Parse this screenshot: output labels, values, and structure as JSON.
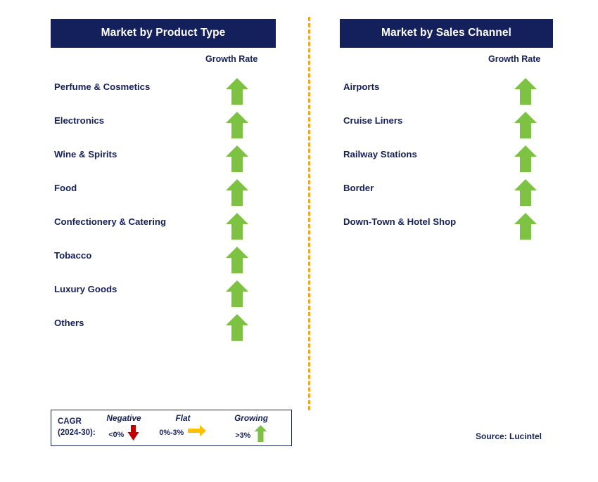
{
  "panels": [
    {
      "title": "Market by Product Type",
      "growth_header": "Growth Rate",
      "rows": [
        {
          "label": "Perfume & Cosmetics",
          "trend": "growing",
          "icon": "arrow-up-icon"
        },
        {
          "label": "Electronics",
          "trend": "growing",
          "icon": "arrow-up-icon"
        },
        {
          "label": "Wine & Spirits",
          "trend": "growing",
          "icon": "arrow-up-icon"
        },
        {
          "label": "Food",
          "trend": "growing",
          "icon": "arrow-up-icon"
        },
        {
          "label": "Confectionery & Catering",
          "trend": "growing",
          "icon": "arrow-up-icon"
        },
        {
          "label": "Tobacco",
          "trend": "growing",
          "icon": "arrow-up-icon"
        },
        {
          "label": "Luxury Goods",
          "trend": "growing",
          "icon": "arrow-up-icon"
        },
        {
          "label": "Others",
          "trend": "growing",
          "icon": "arrow-up-icon"
        }
      ]
    },
    {
      "title": "Market by Sales Channel",
      "growth_header": "Growth Rate",
      "rows": [
        {
          "label": "Airports",
          "trend": "growing",
          "icon": "arrow-up-icon"
        },
        {
          "label": "Cruise Liners",
          "trend": "growing",
          "icon": "arrow-up-icon"
        },
        {
          "label": "Railway Stations",
          "trend": "growing",
          "icon": "arrow-up-icon"
        },
        {
          "label": "Border",
          "trend": "growing",
          "icon": "arrow-up-icon"
        },
        {
          "label": "Down-Town & Hotel Shop",
          "trend": "growing",
          "icon": "arrow-up-icon"
        }
      ]
    }
  ],
  "legend": {
    "cagr_line1": "CAGR",
    "cagr_line2": "(2024-30):",
    "items": [
      {
        "title": "Negative",
        "range": "<0%",
        "icon": "arrow-down-icon",
        "color": "#c00000"
      },
      {
        "title": "Flat",
        "range": "0%-3%",
        "icon": "arrow-right-icon",
        "color": "#ffc000"
      },
      {
        "title": "Growing",
        "range": ">3%",
        "icon": "arrow-up-icon",
        "color": "#7dc242"
      }
    ]
  },
  "source": "Source: Lucintel",
  "colors": {
    "header_bg": "#14205c",
    "text": "#14205c",
    "growing": "#7dc242",
    "negative": "#c00000",
    "flat": "#ffc000",
    "divider": "#f5a623"
  }
}
